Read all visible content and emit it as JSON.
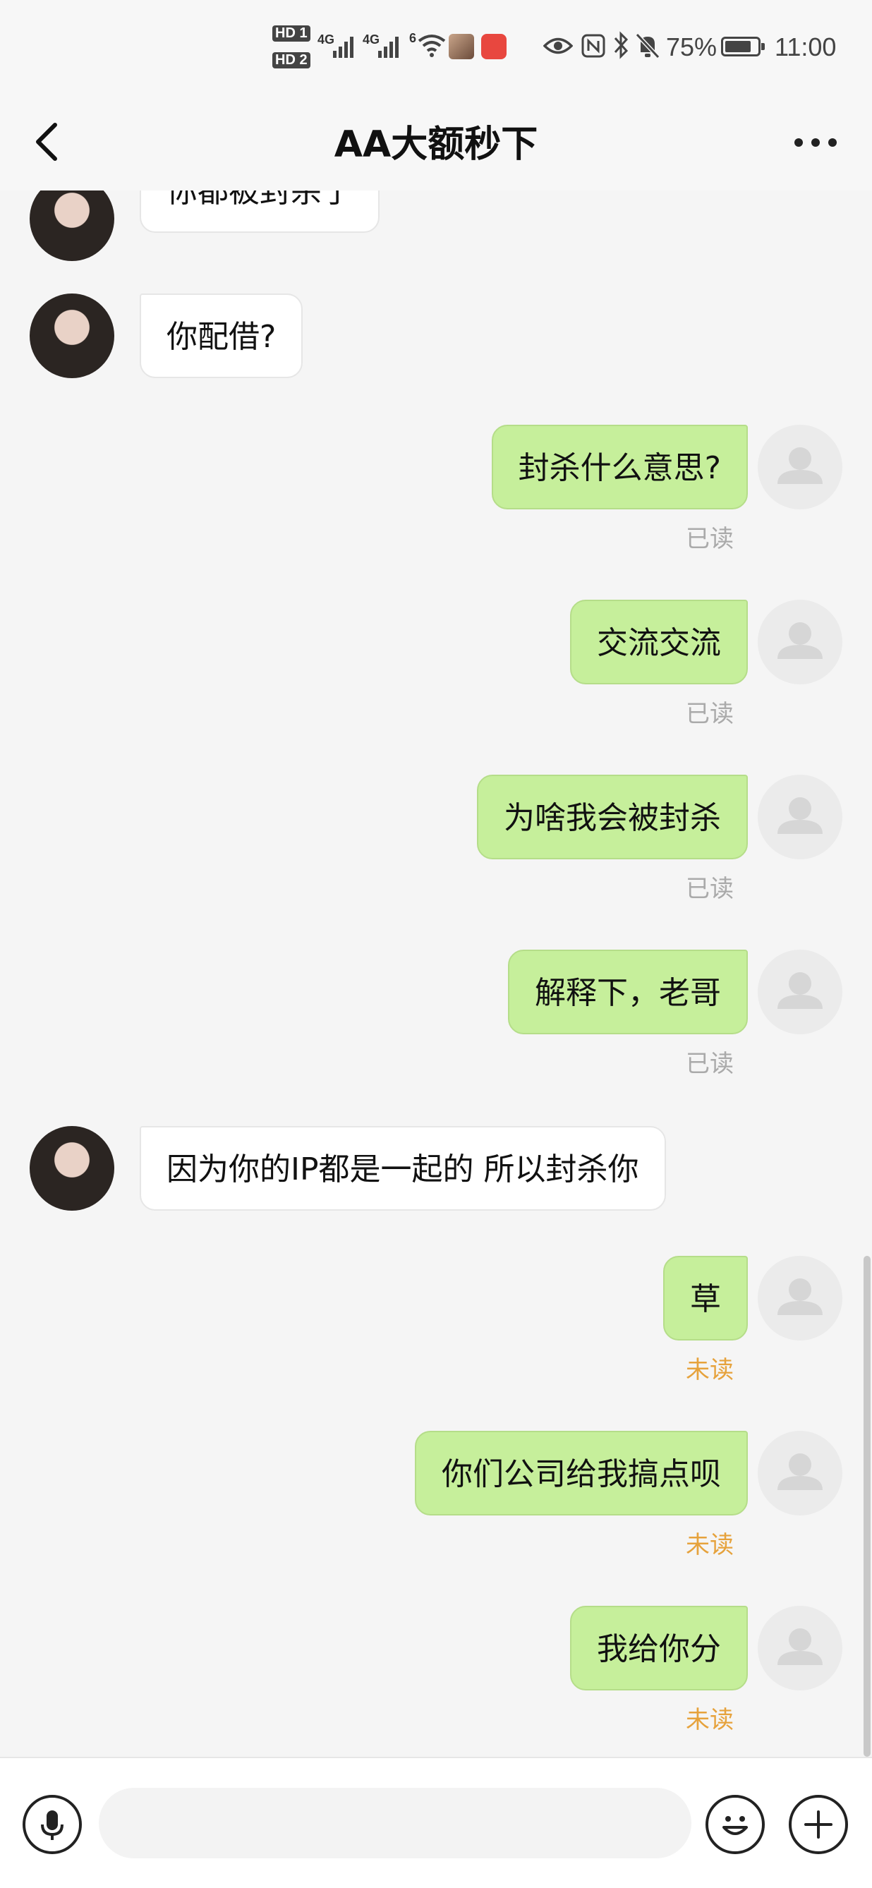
{
  "status_bar": {
    "hd1": "HD 1",
    "hd2": "HD 2",
    "sig1": "4G",
    "sig2": "4G",
    "wifi": "6",
    "battery": "75%",
    "time": "11:00"
  },
  "header": {
    "title": "AA大额秒下"
  },
  "messages": [
    {
      "side": "other",
      "text": "你都被封杀了",
      "status": ""
    },
    {
      "side": "other",
      "text": "你配借?",
      "status": ""
    },
    {
      "side": "self",
      "text": "封杀什么意思?",
      "status": "已读"
    },
    {
      "side": "self",
      "text": "交流交流",
      "status": "已读"
    },
    {
      "side": "self",
      "text": "为啥我会被封杀",
      "status": "已读"
    },
    {
      "side": "self",
      "text": "解释下，老哥",
      "status": "已读"
    },
    {
      "side": "other",
      "text": "因为你的IP都是一起的 所以封杀你",
      "status": ""
    },
    {
      "side": "self",
      "text": "草",
      "status": "未读"
    },
    {
      "side": "self",
      "text": "你们公司给我搞点呗",
      "status": "未读"
    },
    {
      "side": "self",
      "text": "我给你分",
      "status": "未读"
    }
  ],
  "input": {
    "value": "",
    "placeholder": ""
  },
  "icons": {
    "back": "back-arrow-icon",
    "more": "more-dots-icon",
    "voice": "microphone-icon",
    "emoji": "emoji-icon",
    "plus": "plus-icon"
  },
  "colors": {
    "self_bubble": "#c6ef9b",
    "other_bubble": "#ffffff",
    "unread": "#e6a23c",
    "read": "#aaaaaa"
  }
}
